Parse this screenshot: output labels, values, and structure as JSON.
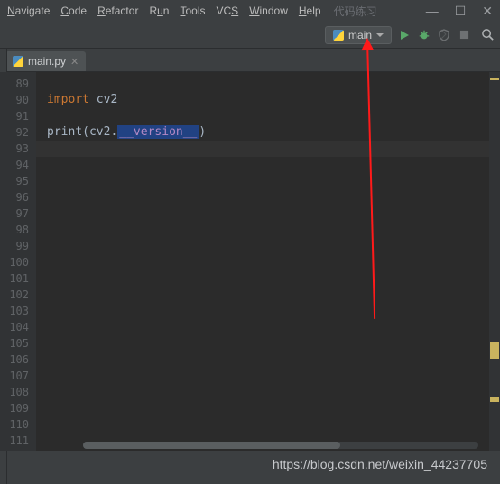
{
  "menu": {
    "navigate": "Navigate",
    "code": "Code",
    "refactor": "Refactor",
    "run": "Run",
    "tools": "Tools",
    "vcs": "VCS",
    "window": "Window",
    "help": "Help"
  },
  "project_name": "代码练习",
  "run_config": {
    "label": "main"
  },
  "tab": {
    "filename": "main.py"
  },
  "gutter": {
    "start": 89,
    "end": 111
  },
  "code": {
    "line90": {
      "kw": "import",
      "rest": " cv2"
    },
    "line92": {
      "fn": "print",
      "open": "(cv2.",
      "hl": "__version__",
      "close": ")"
    }
  },
  "watermark": "https://blog.csdn.net/weixin_44237705"
}
